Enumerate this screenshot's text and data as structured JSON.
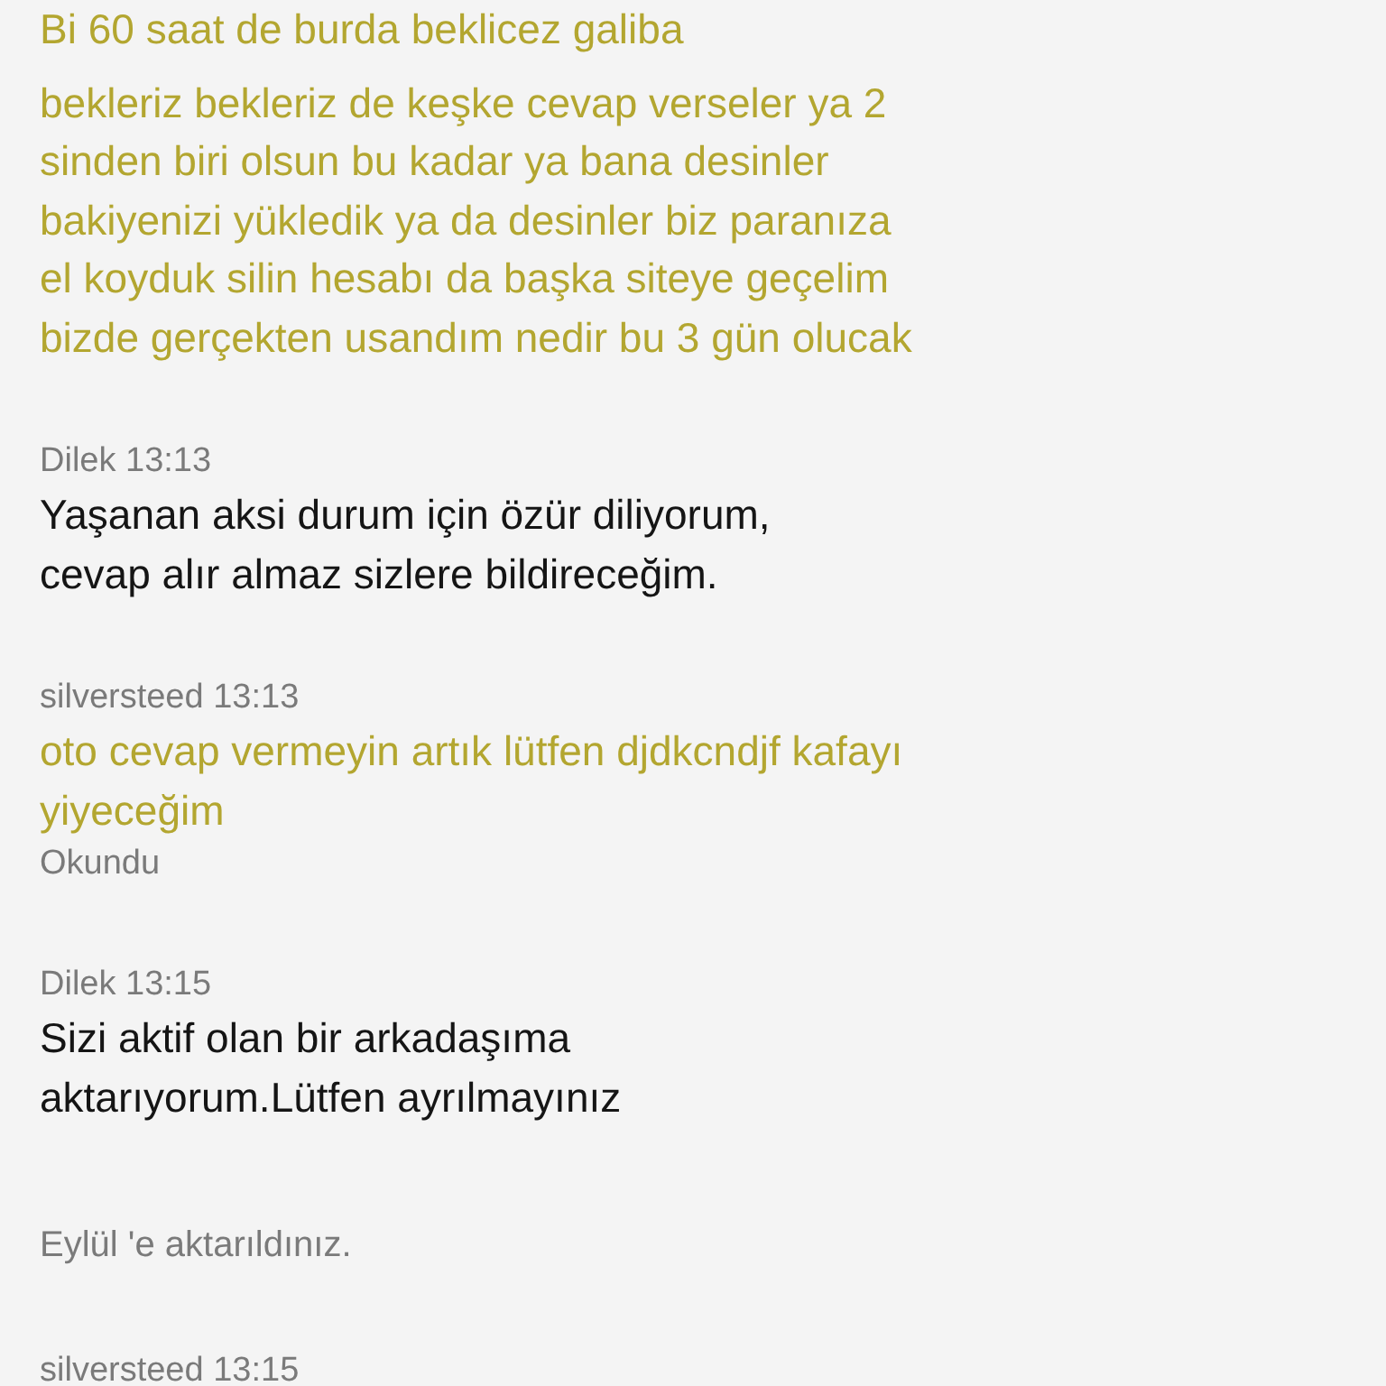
{
  "messages": [
    {
      "kind": "user",
      "text": "Bi 60 saat de burda beklicez galiba"
    },
    {
      "kind": "user",
      "text": "bekleriz bekleriz de keşke cevap verseler ya 2 sinden biri olsun bu kadar ya bana desinler bakiyenizi yükledik ya da desinler biz paranıza el koyduk silin hesabı da başka siteye geçelim bizde gerçekten usandım nedir bu 3 gün olucak"
    },
    {
      "kind": "agent",
      "sender": "Dilek",
      "time": "13:13",
      "text": "Yaşanan aksi durum için özür diliyorum, cevap alır almaz sizlere bildireceğim."
    },
    {
      "kind": "user",
      "sender": "silversteed",
      "time": "13:13",
      "text": "oto cevap vermeyin artık lütfen djdkcndjf kafayı yiyeceğim",
      "status": "Okundu"
    },
    {
      "kind": "agent",
      "sender": "Dilek",
      "time": "13:15",
      "text": "Sizi aktif olan bir arkadaşıma aktarıyorum.Lütfen ayrılmayınız"
    },
    {
      "kind": "system",
      "text": "Eylül 'e aktarıldınız."
    },
    {
      "kind": "user",
      "sender": "silversteed",
      "time": "13:15"
    }
  ]
}
